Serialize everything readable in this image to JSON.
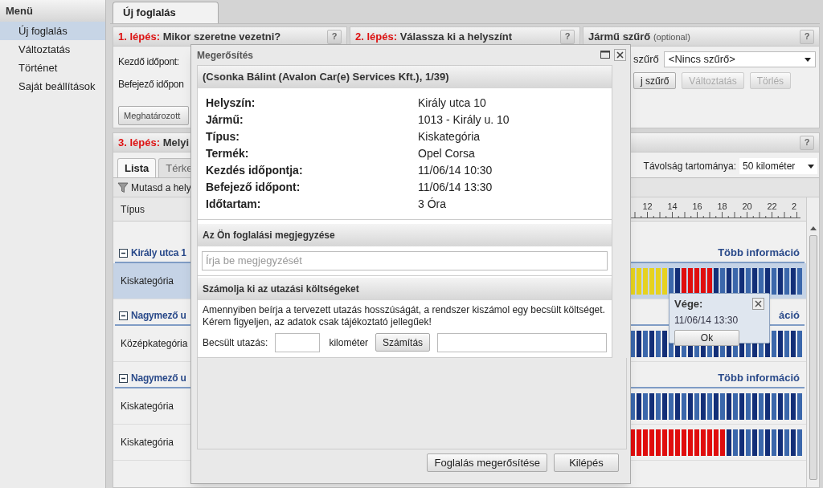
{
  "sidebar": {
    "title": "Menü",
    "items": [
      {
        "label": "Új foglalás",
        "selected": true
      },
      {
        "label": "Változtatás",
        "selected": false
      },
      {
        "label": "Történet",
        "selected": false
      },
      {
        "label": "Saját beállítások",
        "selected": false
      }
    ]
  },
  "tabs": [
    {
      "label": "Új foglalás",
      "selected": true
    }
  ],
  "step1": {
    "step": "1. lépés:",
    "title": "Mikor szeretne vezetni?",
    "help": "?",
    "fields": [
      {
        "label": "Kezdő időpont:"
      },
      {
        "label": "Befejező időpon"
      }
    ],
    "button": "Meghatározott"
  },
  "step2": {
    "step": "2. lépés:",
    "title": "Válassza ki a helyszínt",
    "help": "?"
  },
  "filter": {
    "title": "Jármű szűrő",
    "note": "(optional)",
    "help": "?",
    "label": "szűrő",
    "select": "<Nincs szűrő>",
    "buttons": [
      {
        "label": "j szűrő",
        "disabled": false
      },
      {
        "label": "Változtatás",
        "disabled": true
      },
      {
        "label": "Törlés",
        "disabled": true
      }
    ]
  },
  "step3": {
    "step": "3. lépés:",
    "title": "Melyi",
    "help": "?",
    "tabs": [
      {
        "label": "Lista",
        "selected": true
      },
      {
        "label": "Térke",
        "selected": false
      }
    ],
    "distance_label": "Távolság tartománya:",
    "distance": "50 kilométer",
    "toolbar": "Mutasd a hely",
    "column": "Típus",
    "hours": [
      "12",
      "14",
      "16",
      "18",
      "20",
      "22",
      "2"
    ],
    "groups": [
      {
        "name": "Király utca 1",
        "more": "Több információ",
        "rows": [
          {
            "type": "Kiskategória",
            "selected": true,
            "bars": [
              {
                "kind": "booked",
                "color": "#e6d21f"
              },
              {
                "kind": "booked",
                "color": "#e6d21f"
              },
              {
                "kind": "booked",
                "color": "#e6d21f"
              },
              {
                "kind": "booked",
                "color": "#e6d21f"
              },
              {
                "kind": "booked",
                "color": "#e6d21f"
              },
              {
                "kind": "booked",
                "color": "#e6d21f"
              },
              {
                "kind": "free"
              },
              {
                "kind": "free"
              },
              {
                "kind": "booked",
                "color": "#e00d0d"
              },
              {
                "kind": "booked",
                "color": "#e00d0d"
              },
              {
                "kind": "booked",
                "color": "#e00d0d"
              },
              {
                "kind": "booked",
                "color": "#e00d0d"
              },
              {
                "kind": "booked",
                "color": "#e00d0d"
              },
              {
                "kind": "free"
              },
              {
                "kind": "free"
              },
              {
                "kind": "free"
              },
              {
                "kind": "free"
              },
              {
                "kind": "free"
              },
              {
                "kind": "free"
              },
              {
                "kind": "free"
              },
              {
                "kind": "free"
              },
              {
                "kind": "free"
              },
              {
                "kind": "free"
              },
              {
                "kind": "free"
              },
              {
                "kind": "free"
              },
              {
                "kind": "free"
              },
              {
                "kind": "free"
              }
            ]
          }
        ]
      },
      {
        "name": "Nagymező u",
        "more": "áció",
        "rows": [
          {
            "type": "Középkategória",
            "selected": false,
            "bars": [
              {
                "kind": "free"
              },
              {
                "kind": "free"
              },
              {
                "kind": "free"
              },
              {
                "kind": "free"
              },
              {
                "kind": "free"
              },
              {
                "kind": "free"
              },
              {
                "kind": "free"
              },
              {
                "kind": "free"
              },
              {
                "kind": "free"
              },
              {
                "kind": "free"
              },
              {
                "kind": "free"
              },
              {
                "kind": "free"
              },
              {
                "kind": "free"
              },
              {
                "kind": "free"
              },
              {
                "kind": "free"
              },
              {
                "kind": "free"
              },
              {
                "kind": "free"
              },
              {
                "kind": "free"
              },
              {
                "kind": "free"
              },
              {
                "kind": "free"
              },
              {
                "kind": "free"
              },
              {
                "kind": "free"
              },
              {
                "kind": "free"
              },
              {
                "kind": "free"
              },
              {
                "kind": "free"
              },
              {
                "kind": "free"
              },
              {
                "kind": "free"
              }
            ]
          }
        ]
      },
      {
        "name": "Nagymező u",
        "more": "Több információ",
        "rows": [
          {
            "type": "Kiskategória",
            "selected": false,
            "bars": [
              {
                "kind": "free"
              },
              {
                "kind": "free"
              },
              {
                "kind": "free"
              },
              {
                "kind": "free"
              },
              {
                "kind": "free"
              },
              {
                "kind": "free"
              },
              {
                "kind": "free"
              },
              {
                "kind": "free"
              },
              {
                "kind": "free"
              },
              {
                "kind": "free"
              },
              {
                "kind": "free"
              },
              {
                "kind": "free"
              },
              {
                "kind": "free"
              },
              {
                "kind": "free"
              },
              {
                "kind": "free"
              },
              {
                "kind": "free"
              },
              {
                "kind": "free"
              },
              {
                "kind": "free"
              },
              {
                "kind": "free"
              },
              {
                "kind": "free"
              },
              {
                "kind": "free"
              },
              {
                "kind": "free"
              },
              {
                "kind": "free"
              },
              {
                "kind": "free"
              },
              {
                "kind": "free"
              },
              {
                "kind": "free"
              },
              {
                "kind": "free"
              }
            ]
          },
          {
            "type": "Kiskategória",
            "selected": false,
            "bars": [
              {
                "kind": "booked",
                "color": "#e00d0d"
              },
              {
                "kind": "booked",
                "color": "#e00d0d"
              },
              {
                "kind": "booked",
                "color": "#e00d0d"
              },
              {
                "kind": "booked",
                "color": "#e00d0d"
              },
              {
                "kind": "booked",
                "color": "#e00d0d"
              },
              {
                "kind": "booked",
                "color": "#e00d0d"
              },
              {
                "kind": "booked",
                "color": "#e00d0d"
              },
              {
                "kind": "booked",
                "color": "#e00d0d"
              },
              {
                "kind": "booked",
                "color": "#e00d0d"
              },
              {
                "kind": "booked",
                "color": "#e00d0d"
              },
              {
                "kind": "booked",
                "color": "#e00d0d"
              },
              {
                "kind": "booked",
                "color": "#e00d0d"
              },
              {
                "kind": "booked",
                "color": "#e00d0d"
              },
              {
                "kind": "booked",
                "color": "#e00d0d"
              },
              {
                "kind": "booked",
                "color": "#e00d0d"
              },
              {
                "kind": "free"
              },
              {
                "kind": "free"
              },
              {
                "kind": "free"
              },
              {
                "kind": "free"
              },
              {
                "kind": "free"
              },
              {
                "kind": "free"
              },
              {
                "kind": "free"
              },
              {
                "kind": "free"
              },
              {
                "kind": "free"
              },
              {
                "kind": "free"
              },
              {
                "kind": "free"
              },
              {
                "kind": "free"
              }
            ]
          }
        ]
      }
    ]
  },
  "tooltip": {
    "title": "Vége:",
    "value": "11/06/14 13:30",
    "button": "Ok"
  },
  "dialog": {
    "title": "Megerősítés",
    "header": "(Csonka Bálint (Avalon Car(e) Services Kft.), 1/39)",
    "details": [
      {
        "label": "Helyszín:",
        "value": "Király utca 10"
      },
      {
        "label": "Jármű:",
        "value": "1013 - Király u. 10"
      },
      {
        "label": "Típus:",
        "value": "Kiskategória"
      },
      {
        "label": "Termék:",
        "value": "Opel Corsa"
      },
      {
        "label": "Kezdés időpontja:",
        "value": "11/06/14 10:30"
      },
      {
        "label": "Befejező időpont:",
        "value": "11/06/14 13:30"
      },
      {
        "label": "Időtartam:",
        "value": "3 Óra"
      }
    ],
    "note": {
      "title": "Az Ön foglalási megjegyzése",
      "placeholder": "Írja be megjegyzését"
    },
    "cost": {
      "title": "Számolja ki az utazási költségeket",
      "text": "Amennyiben beírja a tervezett utazás hosszúságát, a rendszer kiszámol egy becsült költséget. Kérem figyeljen, az adatok csak tájékoztató jellegűek!",
      "distance_label": "Becsült utazás:",
      "unit": "kilométer",
      "button": "Számítás"
    },
    "buttons": [
      "Foglalás megerősítése",
      "Kilépés"
    ]
  }
}
